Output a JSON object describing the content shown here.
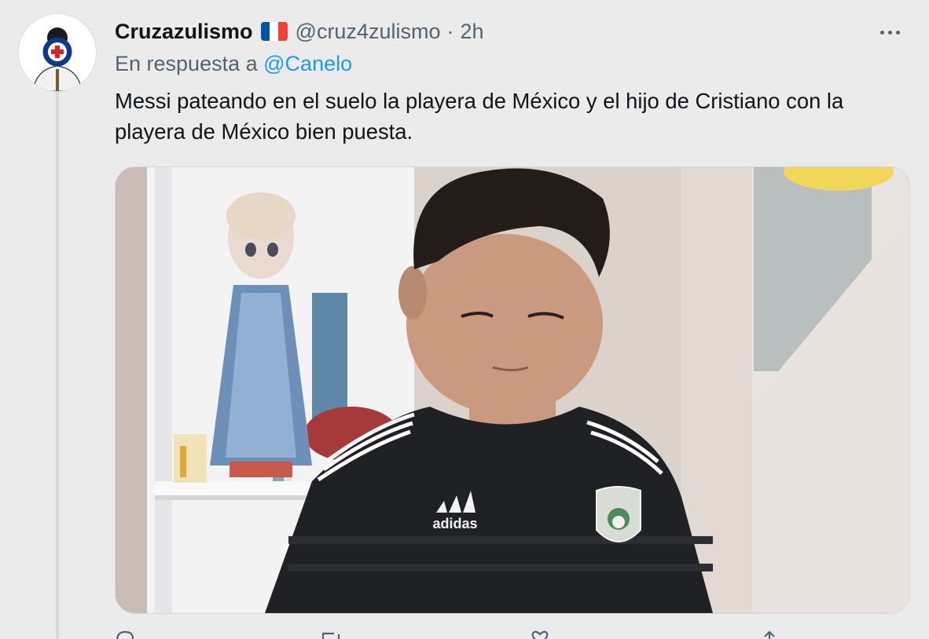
{
  "author": {
    "display_name": "Cruzazulismo",
    "flag_icon": "france-flag-icon",
    "flag_colors": [
      "#0055a4",
      "#ffffff",
      "#ef4135"
    ],
    "handle": "@cruz4zulismo",
    "separator": "·",
    "time": "2h"
  },
  "reply": {
    "prefix": "En respuesta a",
    "mention": "@Canelo"
  },
  "tweet": {
    "text": "Messi pateando en el suelo la playera de México y el hijo de Cristiano con la playera de México bien puesta."
  },
  "media": {
    "type": "photo",
    "jersey_brand": "adidas"
  },
  "actions": [
    "reply-icon",
    "retweet-icon",
    "like-icon",
    "share-icon"
  ],
  "colors": {
    "link": "#1d9bf0",
    "secondary_text": "#536471",
    "primary_text": "#0f1419",
    "background": "#ebebeb"
  }
}
